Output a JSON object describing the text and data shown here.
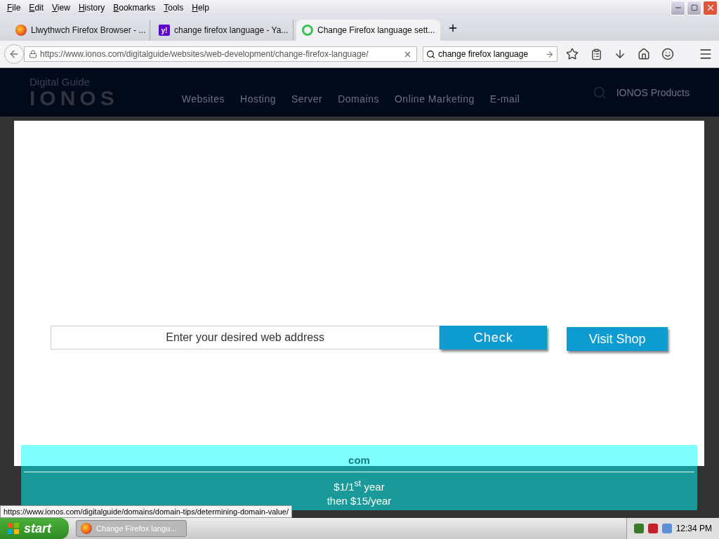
{
  "menu_bar": [
    "File",
    "Edit",
    "View",
    "History",
    "Bookmarks",
    "Tools",
    "Help"
  ],
  "tabs": [
    {
      "title": "Llwythwch Firefox Browser - ...",
      "kind": "firefox",
      "selected": false
    },
    {
      "title": "change firefox language - Ya...",
      "kind": "yahoo",
      "icon_label": "y!",
      "selected": false
    },
    {
      "title": "Change Firefox language sett...",
      "kind": "loading",
      "selected": true
    }
  ],
  "address_bar": {
    "value": "https://www.ionos.com/digitalguide/websites/web-development/change-firefox-language/"
  },
  "search_bar": {
    "value": "change firefox language"
  },
  "site_header": {
    "brand": "Digital Guide",
    "logo": "IONOS",
    "nav": [
      "Websites",
      "Hosting",
      "Server",
      "Domains",
      "Online Marketing",
      "E-mail"
    ],
    "products": "IONOS Products"
  },
  "domain_form": {
    "placeholder": "Enter your desired web address",
    "check": "Check",
    "shop": "Visit Shop"
  },
  "offer": {
    "tld": "com",
    "price": "$1/1$^{st}$ year",
    "then": "then $15/year"
  },
  "status_url": "https://www.ionos.com/digitalguide/domains/domain-tips/determining-domain-value/",
  "taskbar": {
    "start": "start",
    "task": "Change Firefox langu...",
    "clock": "12:34 PM"
  }
}
